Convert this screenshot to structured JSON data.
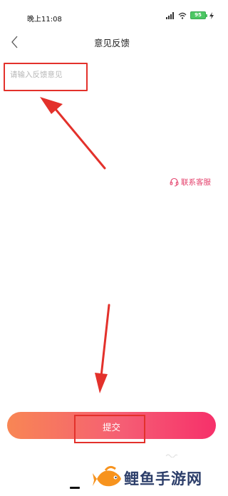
{
  "status_bar": {
    "time": "晚上11:08",
    "battery": "95"
  },
  "nav": {
    "title": "意见反馈"
  },
  "feedback": {
    "placeholder": "请输入反馈意见",
    "value": ""
  },
  "contact": {
    "label": "联系客服"
  },
  "submit": {
    "label": "提交"
  },
  "watermark": {
    "text": "鲤鱼手游网"
  },
  "colors": {
    "accent_pink": "#e4406b",
    "button_gradient_start": "#f88654",
    "button_gradient_end": "#f6306a",
    "annotation_red": "#e3312b"
  },
  "icons": [
    "signal-icon",
    "wifi-icon",
    "battery-icon",
    "charging-icon",
    "back-arrow-icon",
    "headset-icon",
    "fish-logo-icon"
  ]
}
